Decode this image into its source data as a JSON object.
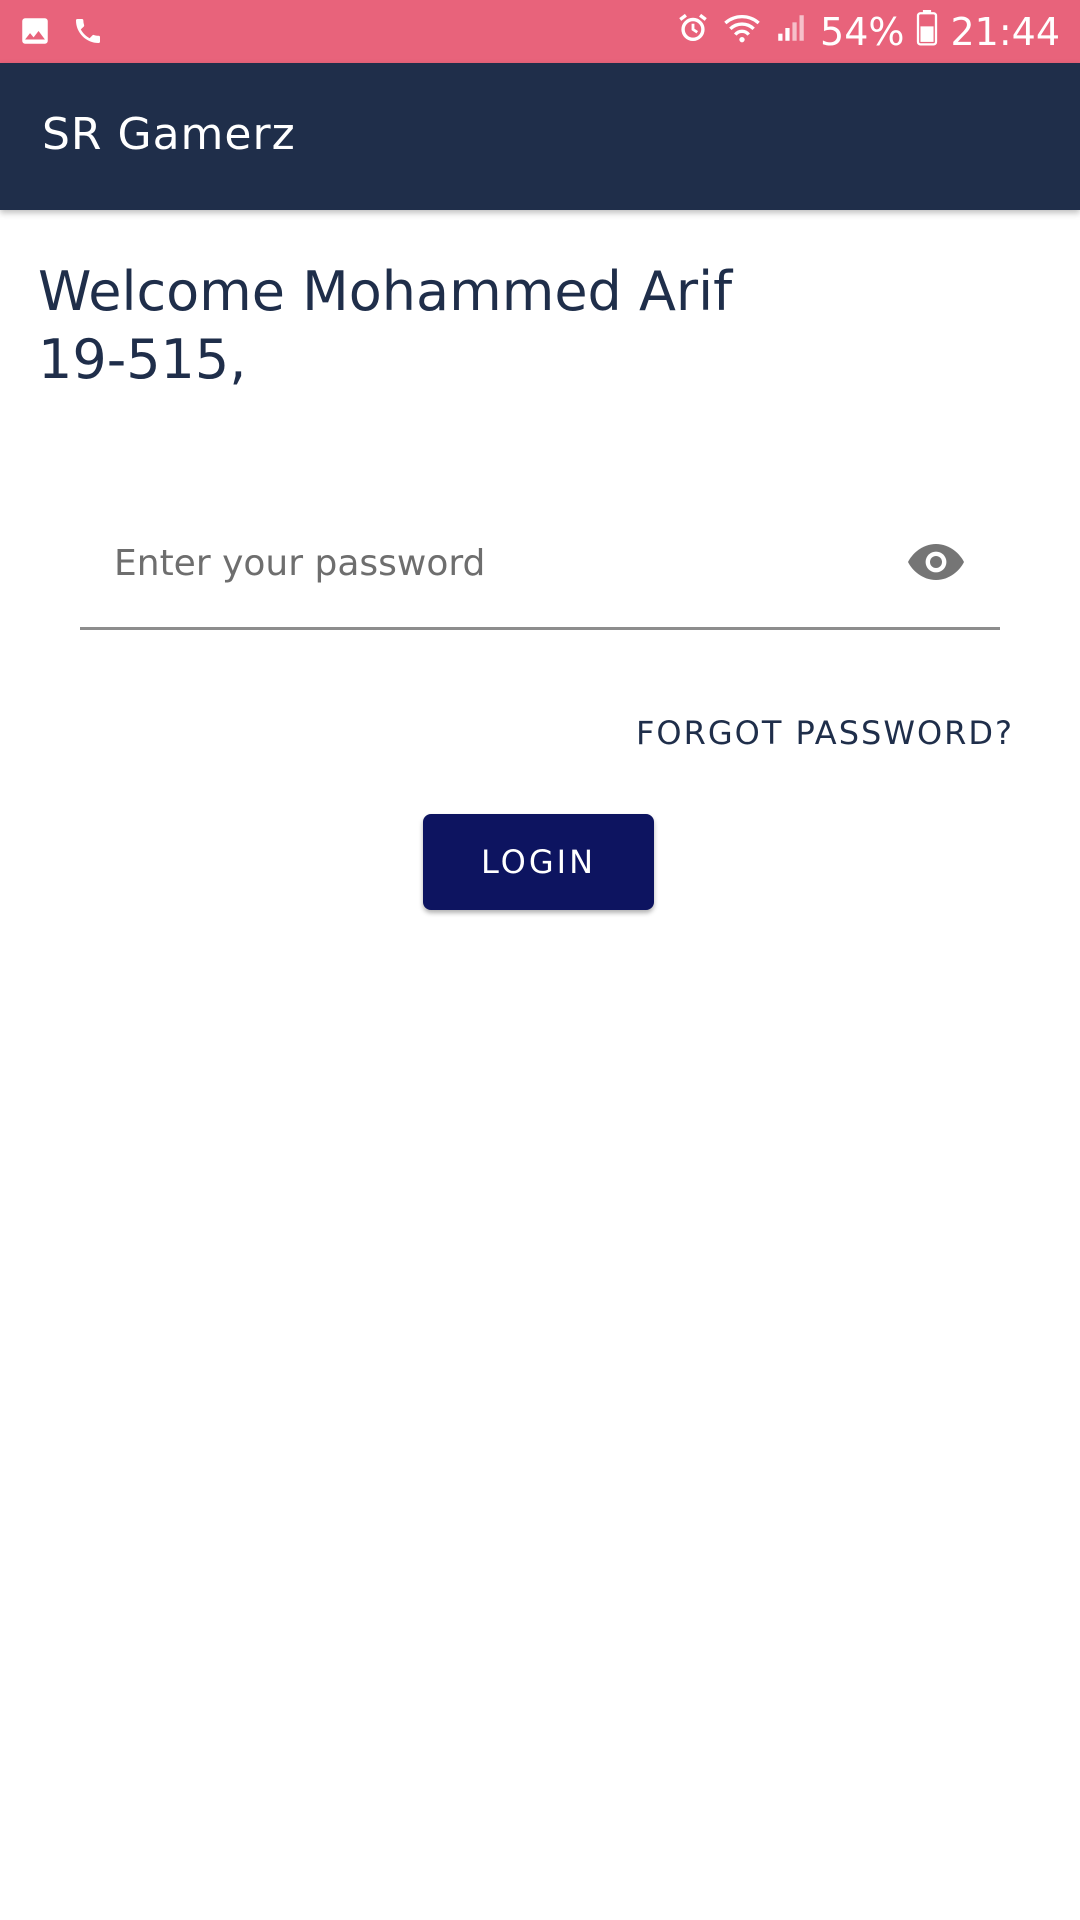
{
  "status_bar": {
    "battery_percent": "54%",
    "time": "21:44",
    "left_icons": [
      "image-icon",
      "phone-icon"
    ],
    "right_icons": [
      "alarm-icon",
      "wifi-icon",
      "signal-icon",
      "battery-icon"
    ]
  },
  "app_bar": {
    "title": "SR Gamerz"
  },
  "main": {
    "welcome_line1": "Welcome Mohammed Arif",
    "welcome_line2": "19-515,",
    "password_placeholder": "Enter your password",
    "password_value": "",
    "forgot_label": "FORGOT PASSWORD?",
    "login_label": "LOGIN"
  },
  "colors": {
    "status_bar": "#e8637b",
    "app_bar": "#1f2e4a",
    "primary_button": "#0d1460",
    "text_dark": "#1f2e4a"
  }
}
